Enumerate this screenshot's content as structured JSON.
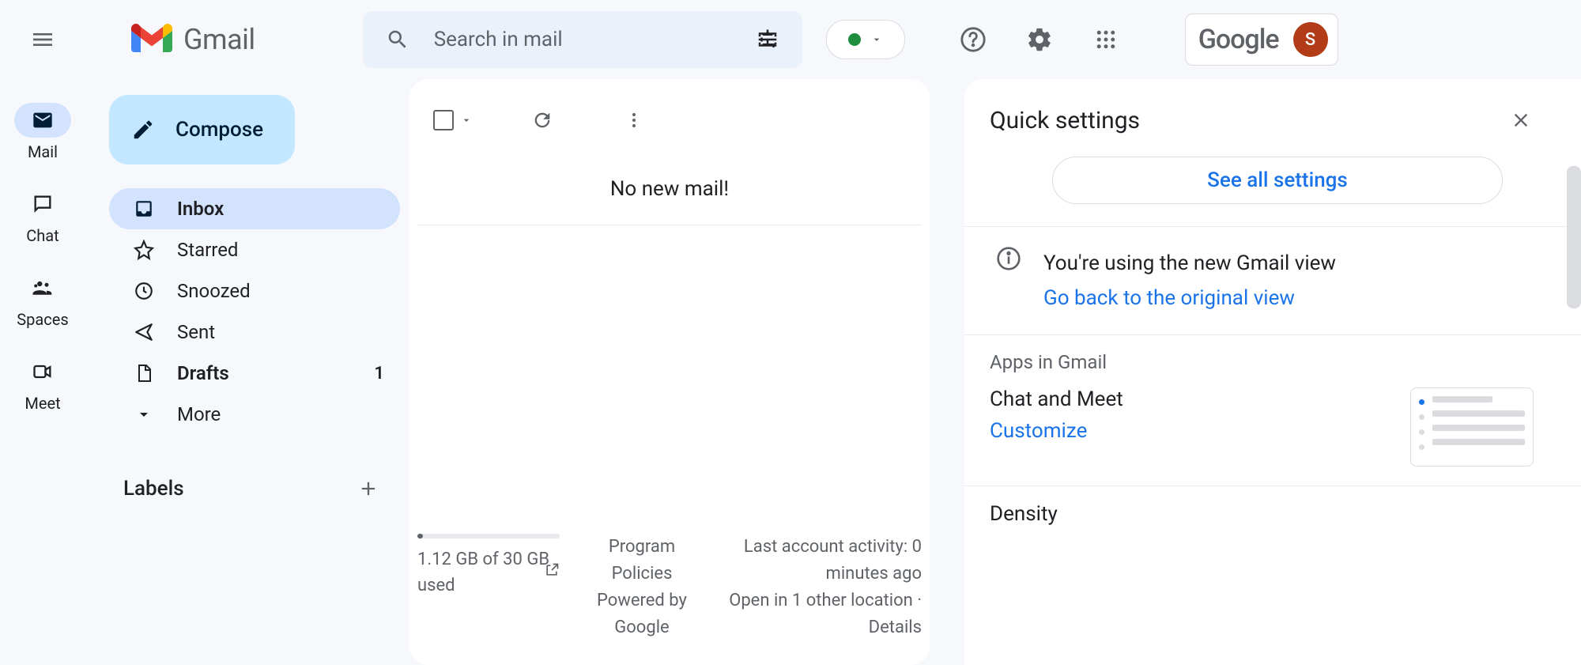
{
  "header": {
    "app_name": "Gmail",
    "search_placeholder": "Search in mail",
    "google_word": "Google",
    "avatar_initial": "S"
  },
  "rail": {
    "items": [
      {
        "label": "Mail",
        "icon": "mail",
        "active": true
      },
      {
        "label": "Chat",
        "icon": "chat",
        "active": false
      },
      {
        "label": "Spaces",
        "icon": "groups",
        "active": false
      },
      {
        "label": "Meet",
        "icon": "video",
        "active": false
      }
    ]
  },
  "sidebar": {
    "compose_label": "Compose",
    "items": [
      {
        "label": "Inbox",
        "icon": "inbox",
        "active": true,
        "bold": true,
        "count": ""
      },
      {
        "label": "Starred",
        "icon": "star",
        "active": false,
        "bold": false,
        "count": ""
      },
      {
        "label": "Snoozed",
        "icon": "clock",
        "active": false,
        "bold": false,
        "count": ""
      },
      {
        "label": "Sent",
        "icon": "send",
        "active": false,
        "bold": false,
        "count": ""
      },
      {
        "label": "Drafts",
        "icon": "draft",
        "active": false,
        "bold": true,
        "count": "1"
      },
      {
        "label": "More",
        "icon": "expand",
        "active": false,
        "bold": false,
        "count": ""
      }
    ],
    "labels_heading": "Labels"
  },
  "main": {
    "empty_message": "No new mail!",
    "storage_used": "1.12 GB of 30 GB used",
    "policies_line1": "Program Policies",
    "policies_line2": "Powered by Google",
    "activity_line1": "Last account activity: 0 minutes ago",
    "activity_line2": "Open in 1 other location · Details"
  },
  "settings": {
    "title": "Quick settings",
    "see_all_label": "See all settings",
    "info_heading": "You're using the new Gmail view",
    "info_link": "Go back to the original view",
    "apps_heading": "Apps in Gmail",
    "chat_meet_label": "Chat and Meet",
    "customize_label": "Customize",
    "density_heading": "Density"
  }
}
